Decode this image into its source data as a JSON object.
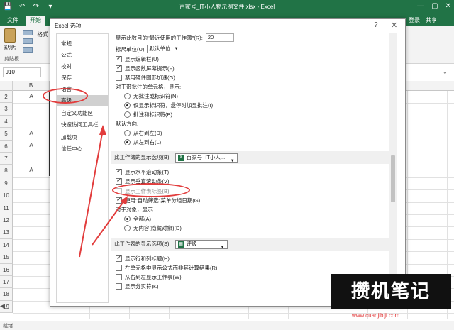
{
  "window": {
    "title": "百家号_IT小人物示例文件.xlsx - Excel",
    "minimize": "—",
    "restore": "▢",
    "close": "✕"
  },
  "qat": {
    "save": "💾",
    "undo": "↶",
    "redo": "↷",
    "more": "▾"
  },
  "tabs": {
    "file": "文件",
    "home": "开始",
    "login": "登录",
    "share": "共享"
  },
  "ribbon": {
    "paste": "粘贴",
    "clipboard": "剪贴板",
    "format_painter": "格式"
  },
  "formula_bar": {
    "namebox": "J10",
    "fx": "⌄"
  },
  "grid": {
    "col_b": "B",
    "rows": [
      "2",
      "3",
      "4",
      "5",
      "6",
      "7",
      "8",
      "9",
      "10",
      "11",
      "12",
      "13",
      "14",
      "15",
      "16",
      "17",
      "18",
      "19"
    ],
    "cells": [
      "A",
      "A",
      "A",
      "A"
    ]
  },
  "status": {
    "ready": "就绪",
    "nav": "◀"
  },
  "dialog": {
    "title": "Excel 选项",
    "help": "?",
    "close": "✕",
    "nav": [
      "常规",
      "公式",
      "校对",
      "保存",
      "语言",
      "高级",
      "自定义功能区",
      "快速访问工具栏",
      "加载项",
      "信任中心"
    ],
    "content": {
      "recent_files_label": "显示此数目的\"最近使用的工作簿\"(R):",
      "recent_files_value": "20",
      "ruler_units_label": "标尺单位(U)",
      "ruler_units_value": "默认单位",
      "show_formula_bar": "显示编辑栏(U)",
      "show_func_tips": "显示函数屏幕提示(F)",
      "disable_hw_accel": "禁用硬件图形加速(G)",
      "comments_label": "对于带批注的单元格，显示:",
      "no_comments": "无批注或标识符(N)",
      "indicators_only": "仅显示标识符，悬停时加显批注(I)",
      "comments_and_indicators": "批注和标识符(B)",
      "direction_label": "默认方向:",
      "rtl": "从右到左(D)",
      "ltr": "从左到右(L)",
      "workbook_section": "此工作簿的显示选项(B):",
      "workbook_name": "百家号_IT小人...",
      "show_hscroll": "显示水平滚动条(T)",
      "show_vscroll": "显示垂直滚动条(V)",
      "show_sheet_tabs": "显示工作表标签(B)",
      "group_dates": "使用\"自动筛选\"菜单分组日期(G)",
      "objects_label": "对于对象，显示:",
      "all": "全部(A)",
      "nothing": "无内容(隐藏对象)(D)",
      "sheet_section": "此工作表的显示选项(S):",
      "sheet_name": "评级",
      "show_headers": "显示行和列标题(H)",
      "show_formulas": "在单元格中显示公式而非其计算结果(R)",
      "rtl_sheet": "从右到左显示工作表(W)",
      "show_page_breaks": "显示分页符(K)"
    }
  },
  "watermark": {
    "brand": "攒机笔记",
    "url": "www.cuanjibiji.com"
  },
  "colors": {
    "excel_green": "#217346",
    "annotation_red": "#e23c3c"
  }
}
